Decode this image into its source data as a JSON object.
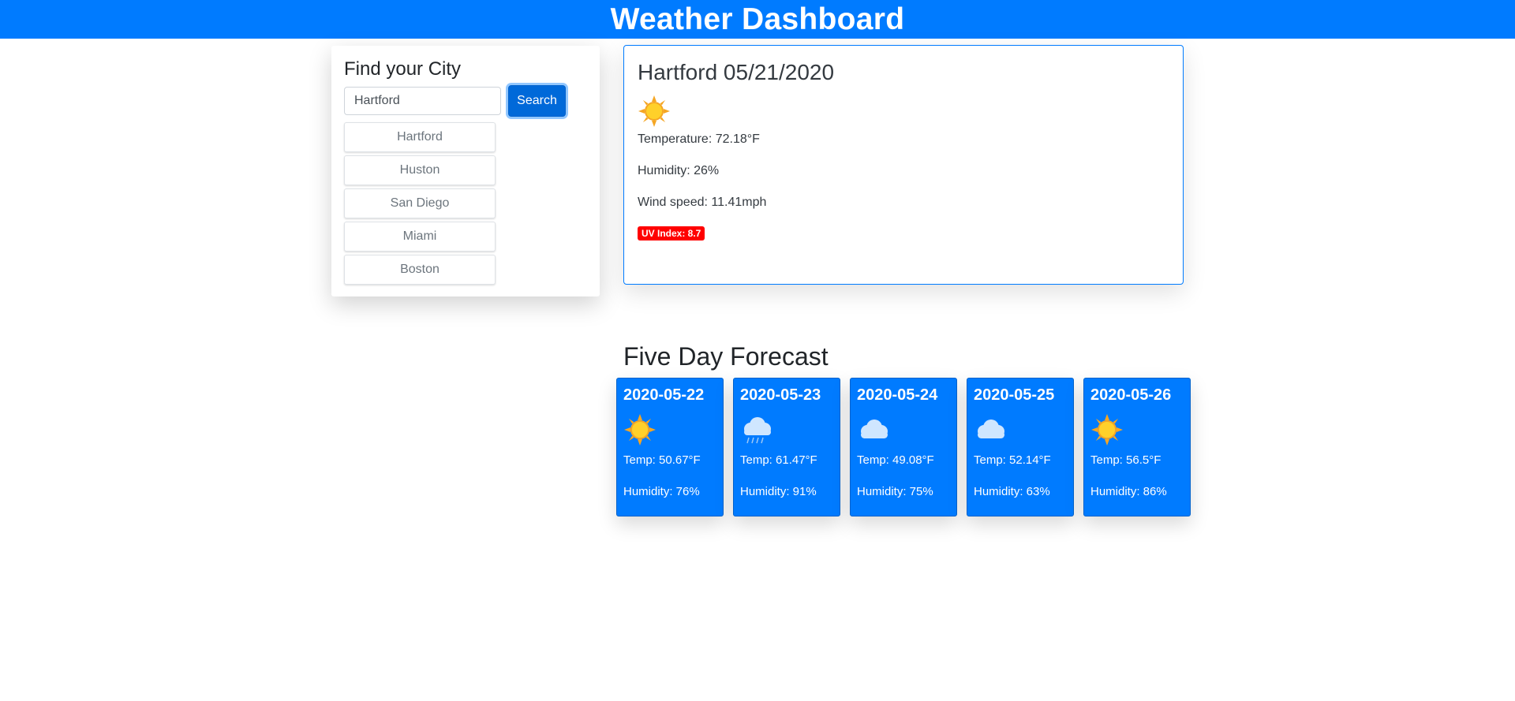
{
  "header": {
    "title": "Weather Dashboard"
  },
  "search": {
    "heading": "Find your City",
    "input_value": "Hartford",
    "button_label": "Search",
    "history": [
      "Hartford",
      "Huston",
      "San Diego",
      "Miami",
      "Boston"
    ]
  },
  "current": {
    "title": "Hartford 05/21/2020",
    "icon": "sun-icon",
    "temperature": "Temperature: 72.18°F",
    "humidity": "Humidity: 26%",
    "wind": "Wind speed: 11.41mph",
    "uv": "UV Index: 8.7",
    "uv_color": "#ff0000"
  },
  "forecast": {
    "heading": "Five Day Forecast",
    "days": [
      {
        "date": "2020-05-22",
        "icon": "sun-icon",
        "temp": "Temp: 50.67°F",
        "humidity": "Humidity: 76%"
      },
      {
        "date": "2020-05-23",
        "icon": "rain-cloud-icon",
        "temp": "Temp: 61.47°F",
        "humidity": "Humidity: 91%"
      },
      {
        "date": "2020-05-24",
        "icon": "cloud-icon",
        "temp": "Temp: 49.08°F",
        "humidity": "Humidity: 75%"
      },
      {
        "date": "2020-05-25",
        "icon": "cloud-icon",
        "temp": "Temp: 52.14°F",
        "humidity": "Humidity: 63%"
      },
      {
        "date": "2020-05-26",
        "icon": "sun-icon",
        "temp": "Temp: 56.5°F",
        "humidity": "Humidity: 86%"
      }
    ]
  },
  "colors": {
    "brand": "#007bff",
    "button": "#0069d9",
    "uv_high": "#ff0000"
  }
}
